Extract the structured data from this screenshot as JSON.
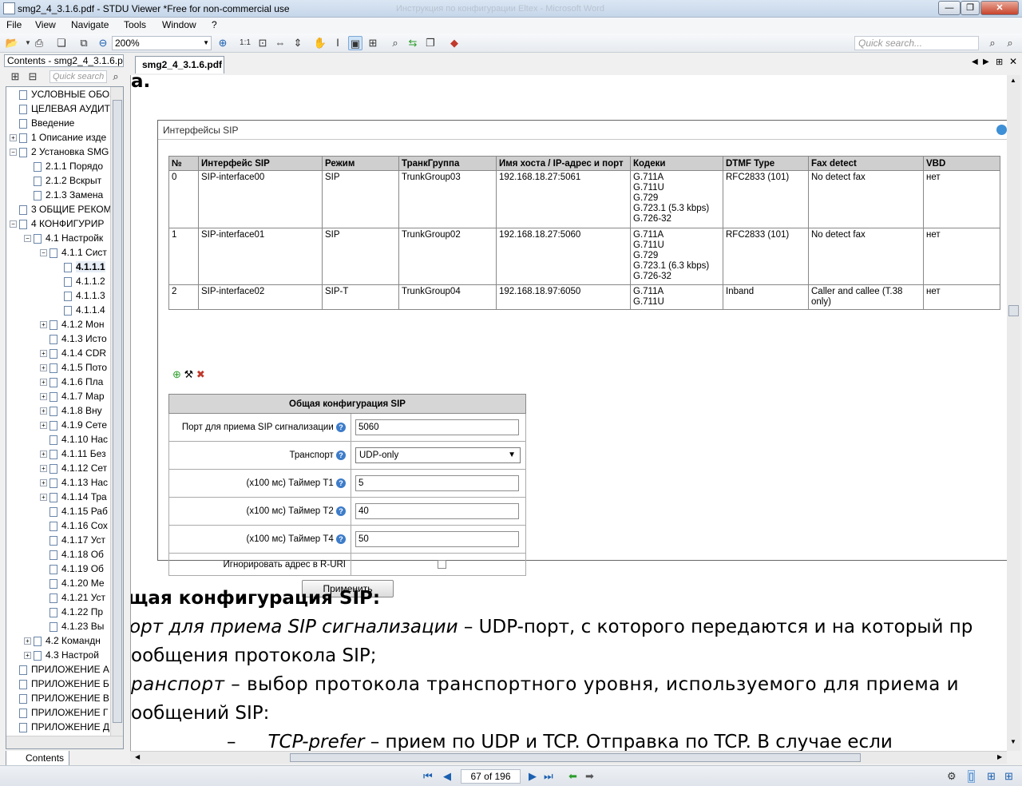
{
  "window": {
    "title": "smg2_4_3.1.6.pdf - STDU Viewer *Free for non-commercial use",
    "background_title": "Инструкция по конфигурации Eltex - Microsoft Word",
    "minimize": "—",
    "restore": "❐",
    "close": "✕"
  },
  "menu": [
    "File",
    "View",
    "Navigate",
    "Tools",
    "Window",
    "?"
  ],
  "toolbar": {
    "zoom": "200%",
    "one_to_one": "1:1",
    "quick_search_placeholder": "Quick search..."
  },
  "left_panel": {
    "title": "Contents - smg2_4_3.1.6.pdf",
    "search_placeholder": "Quick search",
    "tab_label": "Contents",
    "tree": [
      {
        "label": "УСЛОВНЫЕ ОБОЗ",
        "level": 0,
        "exp": ""
      },
      {
        "label": "ЦЕЛЕВАЯ АУДИТ",
        "level": 0,
        "exp": ""
      },
      {
        "label": "Введение",
        "level": 0,
        "exp": ""
      },
      {
        "label": "1 Описание изде",
        "level": 0,
        "exp": "+"
      },
      {
        "label": "2 Установка SMG",
        "level": 0,
        "exp": "−"
      },
      {
        "label": "2.1.1 Порядо",
        "level": 1,
        "exp": ""
      },
      {
        "label": "2.1.2 Вскрыт",
        "level": 1,
        "exp": ""
      },
      {
        "label": "2.1.3 Замена",
        "level": 1,
        "exp": ""
      },
      {
        "label": "3 ОБЩИЕ РЕКОМ",
        "level": 0,
        "exp": ""
      },
      {
        "label": "4 КОНФИГУРИР",
        "level": 0,
        "exp": "−"
      },
      {
        "label": "4.1 Настройк",
        "level": 1,
        "exp": "−"
      },
      {
        "label": "4.1.1 Сист",
        "level": 2,
        "exp": "−"
      },
      {
        "label": "4.1.1.1",
        "level": 3,
        "exp": "",
        "selected": true
      },
      {
        "label": "4.1.1.2",
        "level": 3,
        "exp": ""
      },
      {
        "label": "4.1.1.3",
        "level": 3,
        "exp": ""
      },
      {
        "label": "4.1.1.4",
        "level": 3,
        "exp": ""
      },
      {
        "label": "4.1.2 Мон",
        "level": 2,
        "exp": "+"
      },
      {
        "label": "4.1.3 Исто",
        "level": 2,
        "exp": ""
      },
      {
        "label": "4.1.4 CDR",
        "level": 2,
        "exp": "+"
      },
      {
        "label": "4.1.5 Пото",
        "level": 2,
        "exp": "+"
      },
      {
        "label": "4.1.6 Пла",
        "level": 2,
        "exp": "+"
      },
      {
        "label": "4.1.7 Мар",
        "level": 2,
        "exp": "+"
      },
      {
        "label": "4.1.8  Вну",
        "level": 2,
        "exp": "+"
      },
      {
        "label": "4.1.9 Сете",
        "level": 2,
        "exp": "+"
      },
      {
        "label": "4.1.10 Нас",
        "level": 2,
        "exp": ""
      },
      {
        "label": "4.1.11 Без",
        "level": 2,
        "exp": "+"
      },
      {
        "label": "4.1.12 Сет",
        "level": 2,
        "exp": "+"
      },
      {
        "label": "4.1.13 Нас",
        "level": 2,
        "exp": "+"
      },
      {
        "label": "4.1.14 Тра",
        "level": 2,
        "exp": "+"
      },
      {
        "label": "4.1.15 Раб",
        "level": 2,
        "exp": ""
      },
      {
        "label": "4.1.16 Сох",
        "level": 2,
        "exp": ""
      },
      {
        "label": "4.1.17 Уст",
        "level": 2,
        "exp": ""
      },
      {
        "label": "4.1.18 Об",
        "level": 2,
        "exp": ""
      },
      {
        "label": "4.1.19 Об",
        "level": 2,
        "exp": ""
      },
      {
        "label": "4.1.20 Ме",
        "level": 2,
        "exp": ""
      },
      {
        "label": "4.1.21 Уст",
        "level": 2,
        "exp": ""
      },
      {
        "label": "4.1.22 Пр",
        "level": 2,
        "exp": ""
      },
      {
        "label": "4.1.23 Вы",
        "level": 2,
        "exp": ""
      },
      {
        "label": "4.2 Командн",
        "level": 1,
        "exp": "+"
      },
      {
        "label": "4.3  Настрой",
        "level": 1,
        "exp": "+"
      },
      {
        "label": "ПРИЛОЖЕНИЕ А",
        "level": 0,
        "exp": ""
      },
      {
        "label": "ПРИЛОЖЕНИЕ Б",
        "level": 0,
        "exp": ""
      },
      {
        "label": "ПРИЛОЖЕНИЕ В",
        "level": 0,
        "exp": ""
      },
      {
        "label": "ПРИЛОЖЕНИЕ Г",
        "level": 0,
        "exp": ""
      },
      {
        "label": "ПРИЛОЖЕНИЕ Д",
        "level": 0,
        "exp": ""
      }
    ]
  },
  "doc_tab": "smg2_4_3.1.6.pdf",
  "pdf": {
    "top_fragment": "а.",
    "sip_panel_title": "Интерфейсы SIP",
    "table_headers": [
      "№",
      "Интерфейс SIP",
      "Режим",
      "ТранкГруппа",
      "Имя хоста / IP-адрес и порт",
      "Кодеки",
      "DTMF Type",
      "Fax detect",
      "VBD"
    ],
    "rows": [
      {
        "n": "0",
        "iface": "SIP-interface00",
        "mode": "SIP",
        "trunk": "TrunkGroup03",
        "host": "192.168.18.27:5061",
        "codecs": [
          "G.711A",
          "G.711U",
          "G.729",
          "G.723.1 (5.3 kbps)",
          "G.726-32"
        ],
        "dtmf": "RFC2833 (101)",
        "fax": "No detect fax",
        "vbd": "нет"
      },
      {
        "n": "1",
        "iface": "SIP-interface01",
        "mode": "SIP",
        "trunk": "TrunkGroup02",
        "host": "192.168.18.27:5060",
        "codecs": [
          "G.711A",
          "G.711U",
          "G.729",
          "G.723.1 (6.3 kbps)",
          "G.726-32"
        ],
        "dtmf": "RFC2833 (101)",
        "fax": "No detect fax",
        "vbd": "нет"
      },
      {
        "n": "2",
        "iface": "SIP-interface02",
        "mode": "SIP-T",
        "trunk": "TrunkGroup04",
        "host": "192.168.18.97:6050",
        "codecs": [
          "G.711A",
          "G.711U"
        ],
        "dtmf": "Inband",
        "fax": "Caller and callee (T.38 only)",
        "vbd": "нет"
      }
    ],
    "general_title": "Общая конфигурация SIP",
    "fields": {
      "port_label": "Порт для приема SIP сигнализации",
      "port_value": "5060",
      "transport_label": "Транспорт",
      "transport_value": "UDP-only",
      "t1_label": "(x100 мс) Таймер T1",
      "t1_value": "5",
      "t2_label": "(x100 мс) Таймер T2",
      "t2_value": "40",
      "t4_label": "(x100 мс) Таймер T4",
      "t4_value": "50",
      "ignore_label": "Игнорировать адрес в R-URI",
      "help": "?"
    },
    "apply": "Применить",
    "text": {
      "heading": "щая конфигурация SIP:",
      "line1_italic": "орт для приема SIP сигнализации",
      "line1_rest": " – UDP-порт, с которого передаются и на который пр",
      "line2": "ообщения протокола SIP;",
      "line3_italic": "ранспорт",
      "line3_rest": " – выбор протокола транспортного уровня, используемого для приема и",
      "line4": "ообщений SIP:",
      "line5_dash": "–",
      "line5_italic": "TCP-prefer",
      "line5_rest": " – прием по UDP и TCP. Отправка по TCP. В случае если"
    }
  },
  "status": {
    "page": "67 of 196"
  }
}
